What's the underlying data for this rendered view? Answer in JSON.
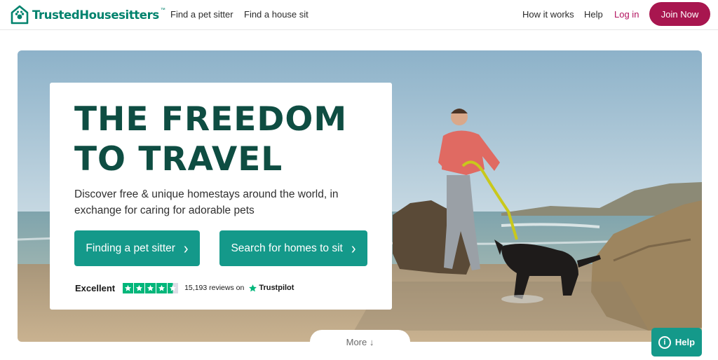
{
  "header": {
    "logo_text": "TrustedHousesitters",
    "logo_tm": "™",
    "nav": {
      "find_pet_sitter": "Find a pet sitter",
      "find_house_sit": "Find a house sit",
      "how_it_works": "How it works",
      "help": "Help",
      "log_in": "Log in",
      "join_now": "Join Now"
    }
  },
  "hero": {
    "headline_line1": "THE FREEDOM",
    "headline_line2": "TO TRAVEL",
    "subtitle": "Discover free & unique homestays around the world, in exchange for caring for adorable pets",
    "cta_primary": "Finding a pet sitter",
    "cta_secondary": "Search for homes to sit",
    "cta_chevron": "›",
    "image_description": "",
    "trustpilot": {
      "rating_word": "Excellent",
      "stars": 4.5,
      "reviews_text": "15,193 reviews on",
      "brand": "Trustpilot"
    }
  },
  "more_label": "More ↓",
  "help_button": {
    "icon_glyph": "i",
    "label": "Help"
  },
  "colors": {
    "brand_green": "#00826d",
    "headline_green": "#0e4d42",
    "button_teal": "#14998a",
    "join_magenta": "#a8164f",
    "login_pink": "#b2125e",
    "trustpilot_green": "#00b67a"
  }
}
